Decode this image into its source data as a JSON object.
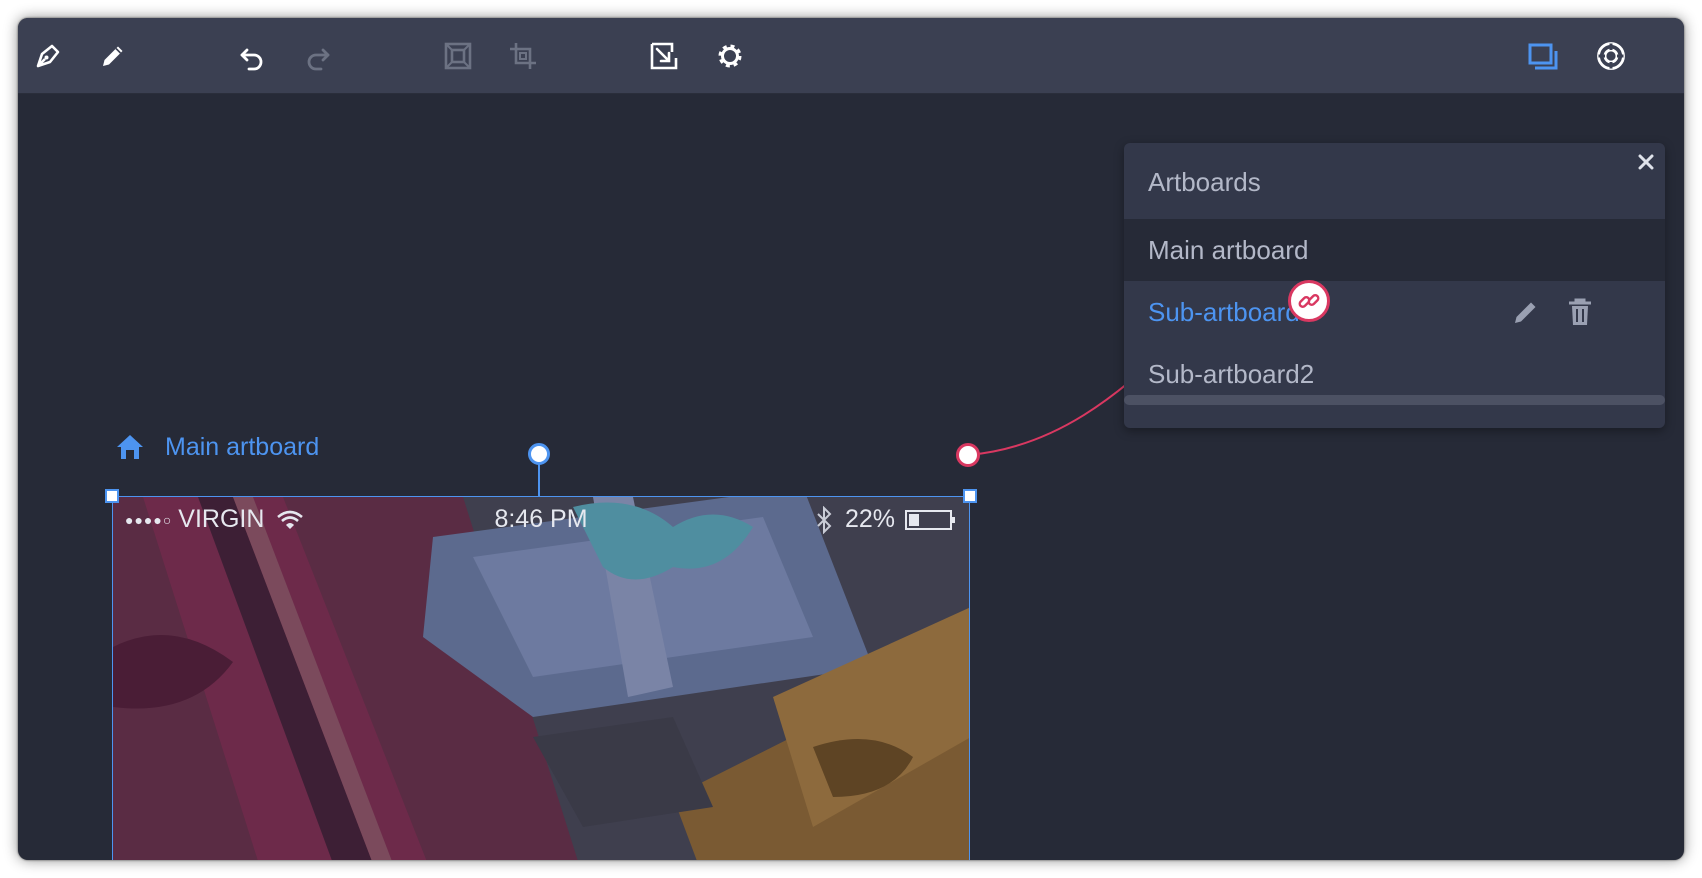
{
  "toolbar": {
    "left_tools": [
      "pen-tool-icon",
      "pencil-icon",
      "undo-icon",
      "redo-icon",
      "frame-icon",
      "crop-icon",
      "resize-icon",
      "settings-gear-icon"
    ],
    "right_tools": [
      "artboards-icon",
      "preview-icon"
    ],
    "active_color": "#4d94f0"
  },
  "panel": {
    "title": "Artboards",
    "rows": [
      {
        "label": "Main artboard"
      },
      {
        "label": "Sub-artboard",
        "active": true
      },
      {
        "label": "Sub-artboard2"
      }
    ]
  },
  "artboard": {
    "label": "Main artboard",
    "statusbar": {
      "carrier": "VIRGIN",
      "signal_dots": "●●●●○",
      "time": "8:46 PM",
      "battery": "22%"
    }
  },
  "colors": {
    "background": "#262a37",
    "toolbar": "#3b4052",
    "accent": "#4d94f0",
    "link": "#d93861",
    "text": "#b3b8c8"
  }
}
